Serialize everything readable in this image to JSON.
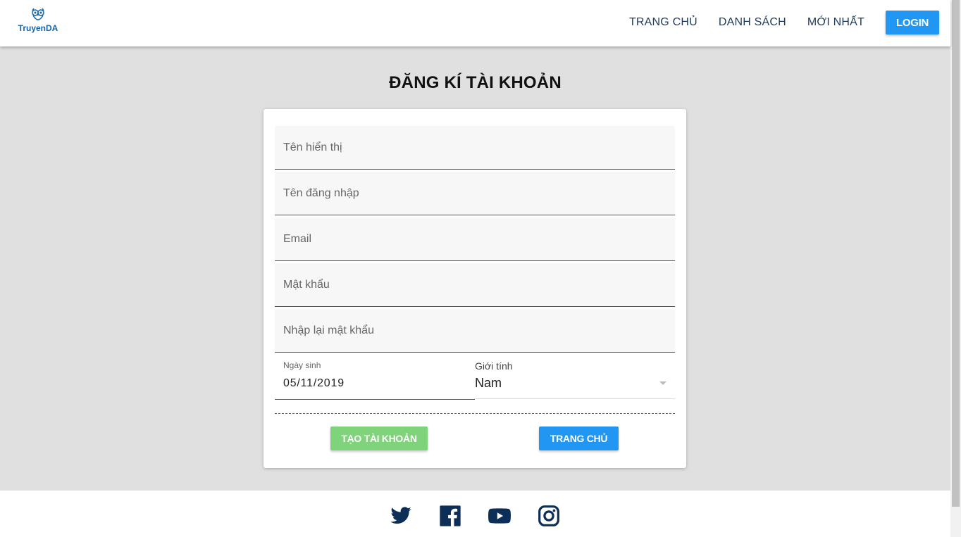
{
  "brand": {
    "name": "TruyenDA",
    "color": "#1565a8"
  },
  "nav": {
    "links": [
      "TRANG CHỦ",
      "DANH SÁCH",
      "MỚI NHẤT"
    ],
    "login_label": "LOGIN"
  },
  "page": {
    "title": "ĐĂNG KÍ TÀI KHOẢN"
  },
  "form": {
    "display_name_placeholder": "Tên hiển thị",
    "username_placeholder": "Tên đăng nhập",
    "email_placeholder": "Email",
    "password_placeholder": "Mật khẩu",
    "confirm_password_placeholder": "Nhập lại mật khẩu",
    "birthday_label": "Ngày sinh",
    "birthday_value": "05/11/2019",
    "gender_label": "Giới tính",
    "gender_value": "Nam",
    "create_label": "TẠO TÀI KHOẢN",
    "home_label": "TRANG CHỦ"
  },
  "footer": {
    "icons": [
      "twitter-icon",
      "facebook-icon",
      "youtube-icon",
      "instagram-icon"
    ]
  },
  "colors": {
    "primary": "#2196f3",
    "success": "#7ed37b",
    "nav_text": "#1e3a5c",
    "footer_icon": "#0d2f57"
  }
}
